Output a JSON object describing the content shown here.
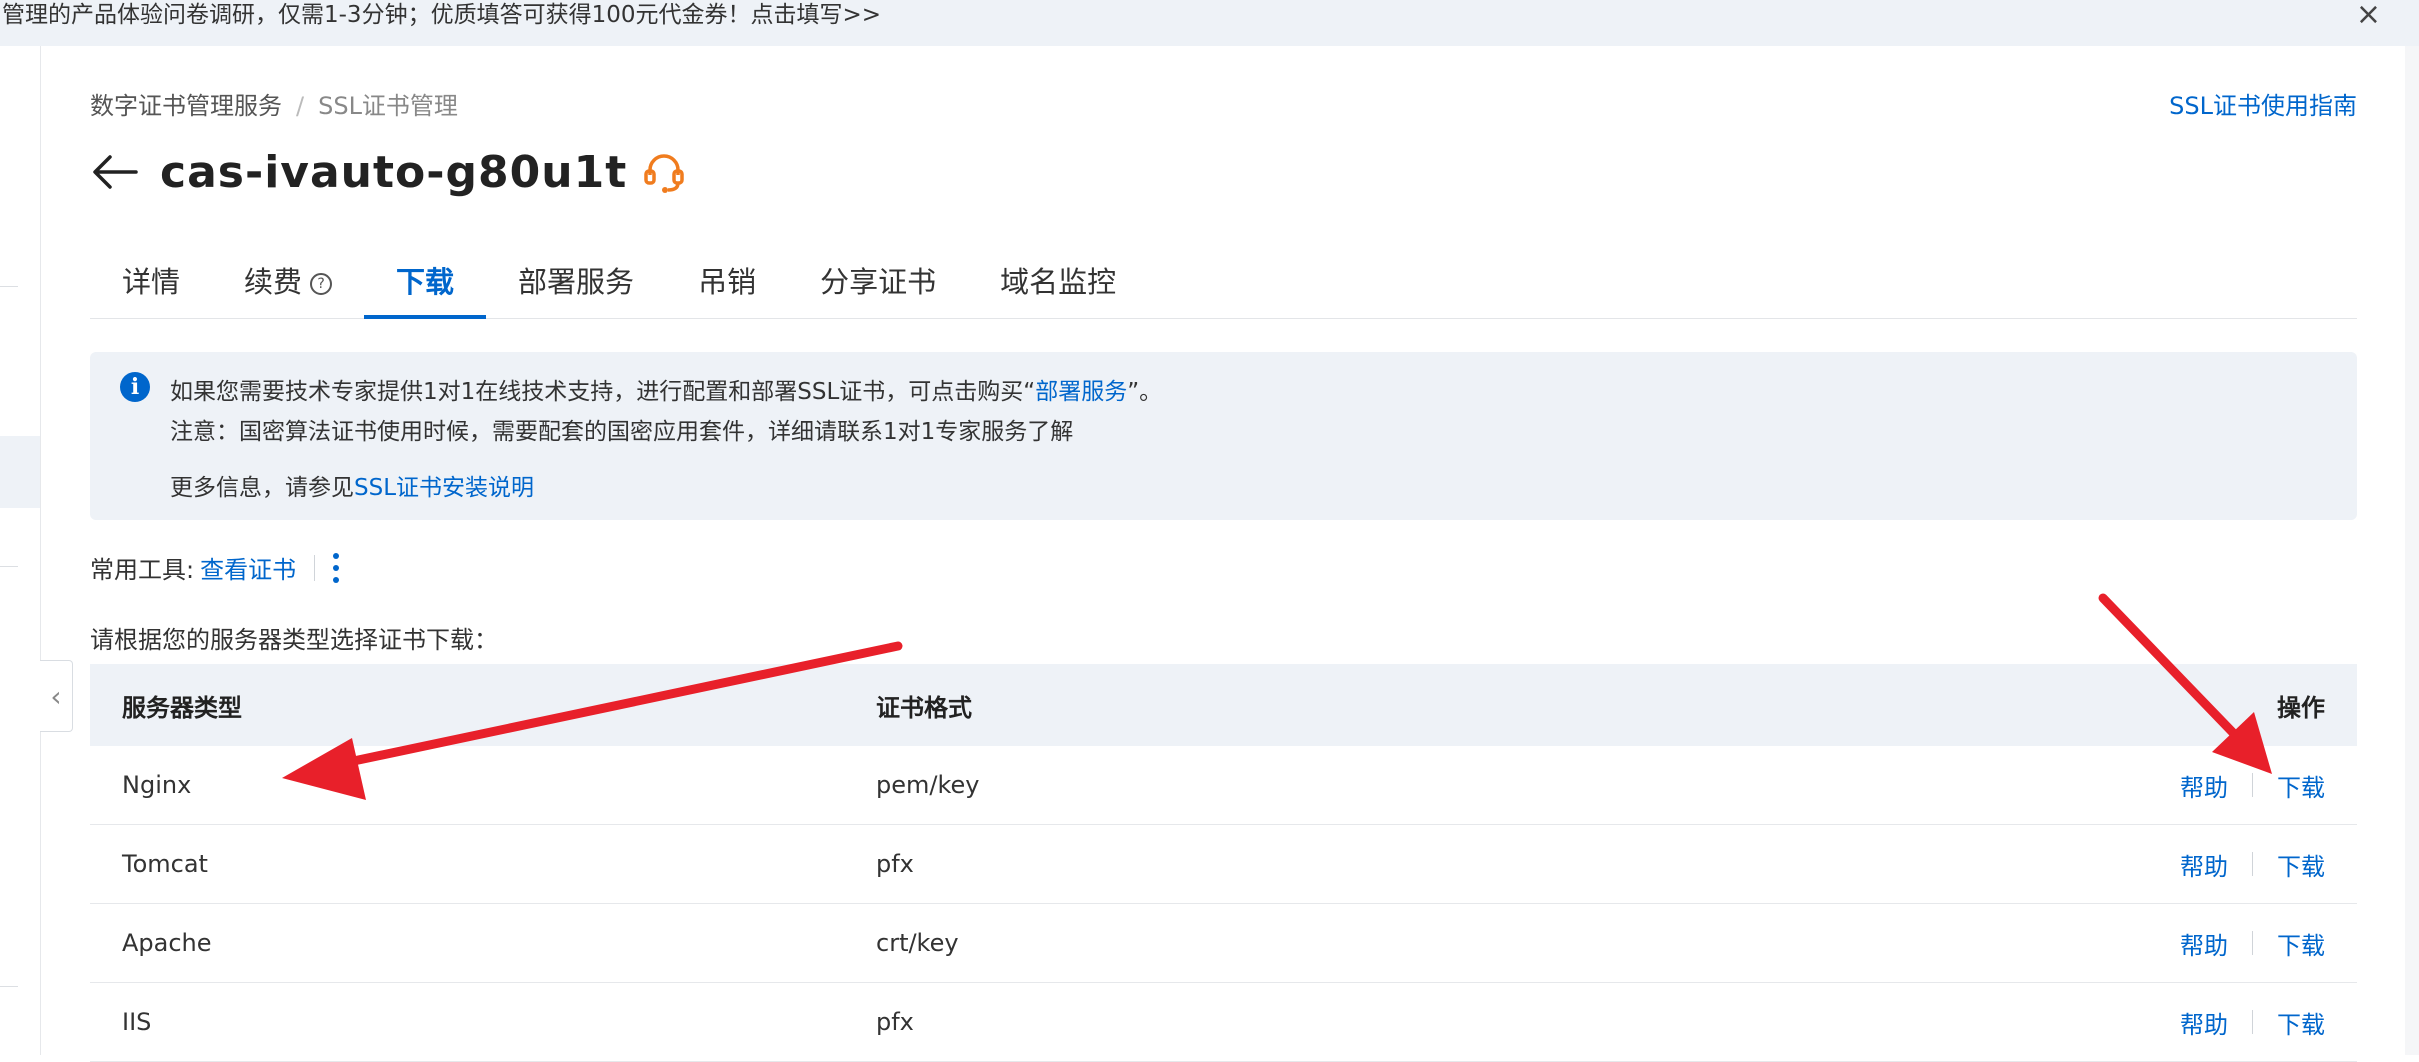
{
  "banner": {
    "text": "管理的产品体验问卷调研，仅需1-3分钟；优质填答可获得100元代金券！点击填写>>",
    "close": "×"
  },
  "breadcrumb": {
    "parent": "数字证书管理服务",
    "separator": "/",
    "current": "SSL证书管理"
  },
  "guide_link": "SSL证书使用指南",
  "page_title": "cas-ivauto-g80u1t",
  "tabs": [
    {
      "label": "详情"
    },
    {
      "label": "续费",
      "help": "?"
    },
    {
      "label": "下载",
      "active": true
    },
    {
      "label": "部署服务"
    },
    {
      "label": "吊销"
    },
    {
      "label": "分享证书"
    },
    {
      "label": "域名监控"
    }
  ],
  "notice": {
    "icon": "i",
    "line1_prefix": "如果您需要技术专家提供1对1在线技术支持，进行配置和部署SSL证书，可点击购买“",
    "line1_link": "部署服务",
    "line1_suffix": "”。",
    "line2": "注意：国密算法证书使用时候，需要配套的国密应用套件，详细请联系1对1专家服务了解",
    "line3_prefix": "更多信息，请参见",
    "line3_link": "SSL证书安装说明"
  },
  "tools": {
    "label": "常用工具:",
    "view_cert": "查看证书"
  },
  "select_tip": "请根据您的服务器类型选择证书下载：",
  "table": {
    "headers": [
      "服务器类型",
      "证书格式",
      "操作"
    ],
    "rows": [
      {
        "server": "Nginx",
        "format": "pem/key",
        "help": "帮助",
        "download": "下载"
      },
      {
        "server": "Tomcat",
        "format": "pfx",
        "help": "帮助",
        "download": "下载"
      },
      {
        "server": "Apache",
        "format": "crt/key",
        "help": "帮助",
        "download": "下载"
      },
      {
        "server": "IIS",
        "format": "pfx",
        "help": "帮助",
        "download": "下载"
      }
    ]
  },
  "colors": {
    "accent": "#0066cc",
    "annotation_arrow": "#e8202a",
    "support_icon": "#f07c1e",
    "notice_bg": "#eef2f7"
  },
  "icons": [
    "close-icon",
    "back-arrow-icon",
    "headset-icon",
    "help-circle-icon",
    "info-icon",
    "more-vertical-icon",
    "chevron-left-icon"
  ]
}
